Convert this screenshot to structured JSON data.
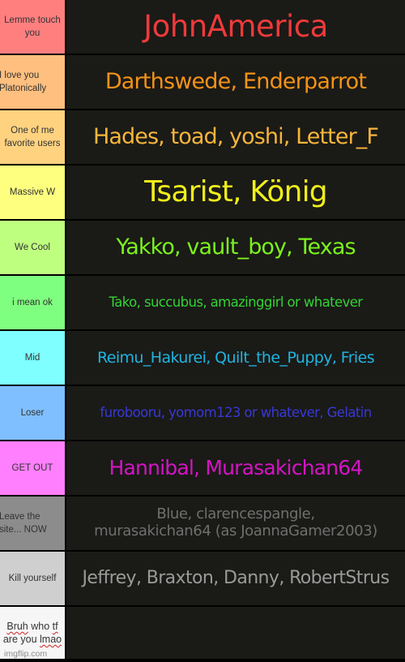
{
  "tiers": [
    {
      "label": "Lemme touch you",
      "content": "JohnAmerica",
      "label_bg": "#ff7f7f",
      "text_color": "#f03a3a"
    },
    {
      "label": "I love you Platonically",
      "content": "Darthswede, Enderparrot",
      "label_bg": "#ffbf7f",
      "text_color": "#f59317"
    },
    {
      "label": "One of me favorite users",
      "content": "Hades, toad, yoshi, Letter_F",
      "label_bg": "#ffd280",
      "text_color": "#f7b53c"
    },
    {
      "label": "Massive W",
      "content": "Tsarist, König",
      "label_bg": "#ffff7f",
      "text_color": "#f0ef1a"
    },
    {
      "label": "We Cool",
      "content": "Yakko, vault_boy, Texas",
      "label_bg": "#bfff7f",
      "text_color": "#7bf21c"
    },
    {
      "label": "i mean ok",
      "content": "Tako, succubus, amazinggirl or whatever",
      "label_bg": "#7fff7f",
      "text_color": "#34d234"
    },
    {
      "label": "Mid",
      "content": "Reimu_Hakurei, Quilt_the_Puppy, Fries",
      "label_bg": "#7fffff",
      "text_color": "#20b4e0"
    },
    {
      "label": "Loser",
      "content": "furobooru, yomom123 or whatever, Gelatin",
      "label_bg": "#7fbfff",
      "text_color": "#3838d8"
    },
    {
      "label": "GET OUT",
      "content": "Hannibal, Murasakichan64",
      "label_bg": "#ff7fff",
      "text_color": "#d414c4"
    },
    {
      "label": "Leave the site... NOW",
      "content": "Blue, clarencespangle, murasakichan64 (as JoannaGamer2003)",
      "label_bg": "#8c8c8c",
      "text_color": "#6f6f6f"
    },
    {
      "label": "Kill yourself",
      "content": "Jeffrey, Braxton, Danny, RobertStrus",
      "label_bg": "#cfcfcf",
      "text_color": "#9a9a9a"
    },
    {
      "label": "Bruh who tf are you lmao",
      "content": "",
      "label_bg": "#f6f6f6",
      "text_color": "#ffffff"
    }
  ],
  "label_lines": {
    "t0": [
      "Lemme touch",
      "you"
    ],
    "t1": [
      "I love you",
      "Platonically"
    ],
    "t2": [
      "One of me",
      "favorite users"
    ],
    "t9": [
      "Leave the",
      "site... NOW"
    ],
    "t11_a": "Bruh",
    "t11_b": " who ",
    "t11_c": "tf",
    "t11_d": "are you ",
    "t11_e": "lmao"
  },
  "content_lines": {
    "t9_line1": "Blue, clarencespangle,",
    "t9_line2": "murasakichan64 (as JoannaGamer2003)"
  },
  "watermark": "imgflip.com"
}
